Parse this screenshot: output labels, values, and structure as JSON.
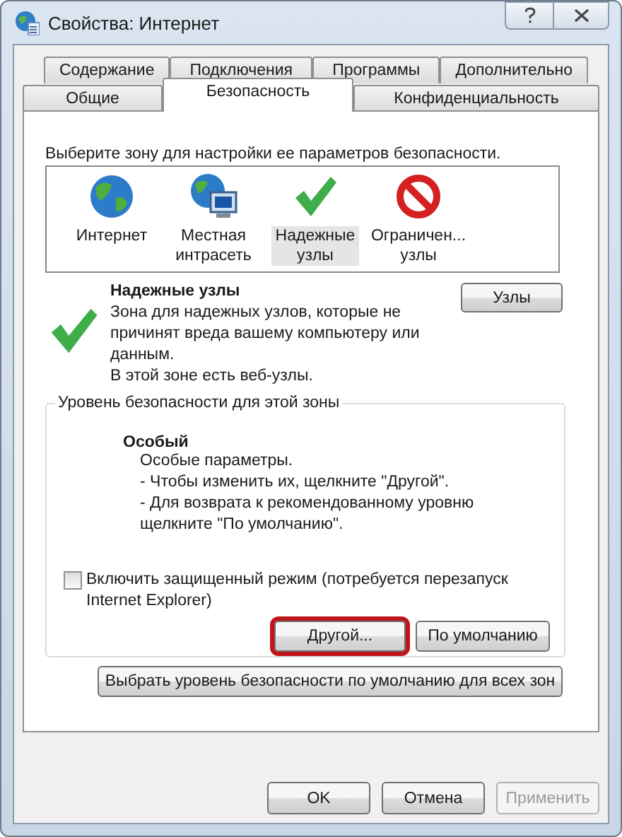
{
  "window": {
    "title": "Свойства: Интернет"
  },
  "tab_rows": [
    [
      {
        "label": "Содержание",
        "selected": false
      },
      {
        "label": "Подключения",
        "selected": false
      },
      {
        "label": "Программы",
        "selected": false
      },
      {
        "label": "Дополнительно",
        "selected": false
      }
    ],
    [
      {
        "label": "Общие",
        "selected": false
      },
      {
        "label": "Безопасность",
        "selected": true
      },
      {
        "label": "Конфиденциальность",
        "selected": false
      }
    ]
  ],
  "zone_prompt": "Выберите зону для настройки ее параметров безопасности.",
  "zones": [
    {
      "kind": "internet",
      "lines": [
        "Интернет"
      ],
      "selected": false
    },
    {
      "kind": "intranet",
      "lines": [
        "Местная",
        "интрасеть"
      ],
      "selected": false
    },
    {
      "kind": "trusted",
      "lines": [
        "Надежные",
        "узлы"
      ],
      "selected": true
    },
    {
      "kind": "restricted",
      "lines": [
        "Ограничен...",
        "узлы"
      ],
      "selected": false
    }
  ],
  "zone_info": {
    "title": "Надежные узлы",
    "description": "Зона для надежных узлов, которые не причинят вреда вашему компьютеру или данным.",
    "note": "В этой зоне есть веб-узлы.",
    "sites_button": "Узлы"
  },
  "security_level": {
    "legend": "Уровень безопасности для этой зоны",
    "name": "Особый",
    "lines": [
      "Особые параметры.",
      "- Чтобы изменить их, щелкните \"Другой\".",
      "- Для возврата к рекомендованному уровню щелкните \"По умолчанию\"."
    ],
    "protected_mode": {
      "label": "Включить защищенный режим (потребуется перезапуск Internet Explorer)",
      "checked": false
    },
    "buttons": [
      {
        "label": "Другой...",
        "highlighted": true
      },
      {
        "label": "По умолчанию",
        "highlighted": false
      }
    ]
  },
  "reset_all_button": "Выбрать уровень безопасности по умолчанию для всех зон",
  "footer_buttons": [
    {
      "label": "OK",
      "disabled": false
    },
    {
      "label": "Отмена",
      "disabled": false
    },
    {
      "label": "Применить",
      "disabled": true
    }
  ]
}
